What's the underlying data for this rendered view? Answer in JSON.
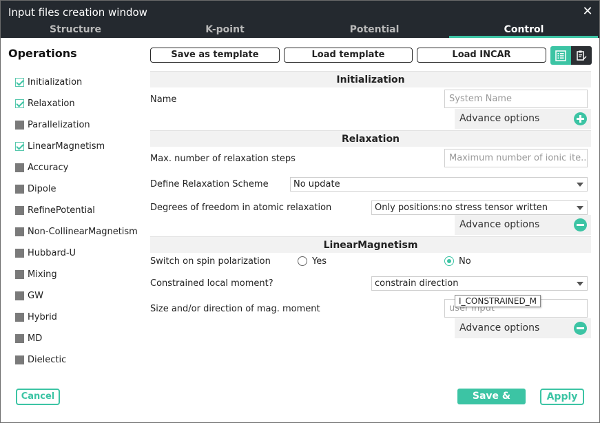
{
  "window": {
    "title": "Input files creation window",
    "close_icon": "close-icon"
  },
  "tabs": [
    {
      "label": "Structure"
    },
    {
      "label": "K-point"
    },
    {
      "label": "Potential"
    },
    {
      "label": "Control",
      "active": true
    }
  ],
  "operations": {
    "title": "Operations",
    "items": [
      {
        "label": "Initialization",
        "checked": true
      },
      {
        "label": "Relaxation",
        "checked": true
      },
      {
        "label": "Parallelization",
        "checked": false
      },
      {
        "label": "LinearMagnetism",
        "checked": true
      },
      {
        "label": "Accuracy",
        "checked": false
      },
      {
        "label": "Dipole",
        "checked": false
      },
      {
        "label": "RefinePotential",
        "checked": false
      },
      {
        "label": "Non-CollinearMagnetism",
        "checked": false
      },
      {
        "label": "Hubbard-U",
        "checked": false
      },
      {
        "label": "Mixing",
        "checked": false
      },
      {
        "label": "GW",
        "checked": false
      },
      {
        "label": "Hybrid",
        "checked": false
      },
      {
        "label": "MD",
        "checked": false
      },
      {
        "label": "Dielectic",
        "checked": false
      }
    ]
  },
  "toolbar": {
    "save_template": "Save as template",
    "load_template": "Load template",
    "load_incar": "Load INCAR",
    "icons": [
      "list-view-icon",
      "clipboard-edit-icon"
    ]
  },
  "sections": {
    "initialization": {
      "title": "Initialization",
      "name_label": "Name",
      "name_placeholder": "System Name",
      "advance_label": "Advance options"
    },
    "relaxation": {
      "title": "Relaxation",
      "max_steps_label": "Max. number of relaxation steps",
      "max_steps_placeholder": "Maximum number of ionic ite...",
      "scheme_label": "Define Relaxation Scheme",
      "scheme_value": "No update",
      "dof_label": "Degrees of freedom in atomic relaxation",
      "dof_value": "Only positions:no stress tensor written",
      "advance_label": "Advance options"
    },
    "linear_magnetism": {
      "title": "LinearMagnetism",
      "spin_label": "Switch on spin polarization",
      "yes_label": "Yes",
      "no_label": "No",
      "selected": "No",
      "constrained_label": "Constrained local moment?",
      "constrained_value": "constrain direction",
      "moment_label": "Size and/or direction of mag. moment",
      "moment_placeholder": "user input",
      "tooltip": "I_CONSTRAINED_M",
      "advance_label": "Advance options"
    }
  },
  "footer": {
    "cancel": "Cancel",
    "save_close": "Save & Close",
    "apply": "Apply"
  },
  "colors": {
    "accent": "#3cc4a4",
    "titlebar": "#24292f"
  }
}
